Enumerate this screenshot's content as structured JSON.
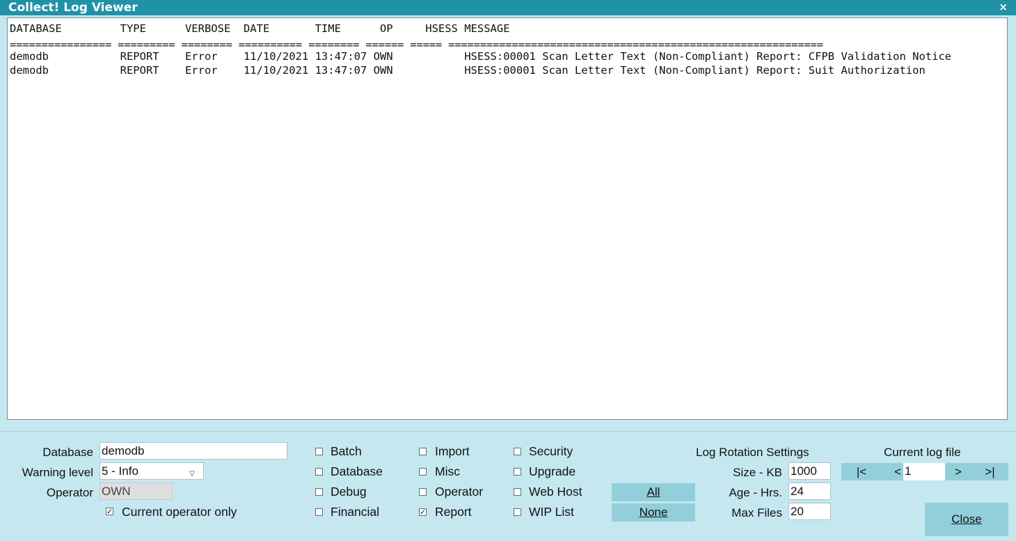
{
  "window": {
    "title": "Collect! Log Viewer",
    "close_glyph": "×"
  },
  "log": {
    "header_line": "DATABASE         TYPE      VERBOSE  DATE       TIME      OP     HSESS MESSAGE",
    "rule_line": "================ ========= ======== ========== ======== ====== ===== ===========================================================",
    "rows": [
      "demodb           REPORT    Error    11/10/2021 13:47:07 OWN           HSESS:00001 Scan Letter Text (Non-Compliant) Report: CFPB Validation Notice",
      "demodb           REPORT    Error    11/10/2021 13:47:07 OWN           HSESS:00001 Scan Letter Text (Non-Compliant) Report: Suit Authorization"
    ]
  },
  "filters": {
    "database_label": "Database",
    "database_value": "demodb",
    "warning_label": "Warning level",
    "warning_value": "5 - Info",
    "operator_label": "Operator",
    "operator_value": "OWN",
    "current_operator_label": "Current operator only",
    "current_operator_checked": true
  },
  "types": [
    {
      "label": "Batch",
      "checked": false
    },
    {
      "label": "Database",
      "checked": false
    },
    {
      "label": "Debug",
      "checked": false
    },
    {
      "label": "Financial",
      "checked": false
    },
    {
      "label": "Import",
      "checked": false
    },
    {
      "label": "Misc",
      "checked": false
    },
    {
      "label": "Operator",
      "checked": false
    },
    {
      "label": "Report",
      "checked": true
    },
    {
      "label": "Security",
      "checked": false
    },
    {
      "label": "Upgrade",
      "checked": false
    },
    {
      "label": "Web Host",
      "checked": false
    },
    {
      "label": "WIP List",
      "checked": false
    }
  ],
  "buttons": {
    "all": "All",
    "none": "None",
    "close": "Close"
  },
  "rotation": {
    "title": "Log Rotation Settings",
    "size_label": "Size - KB",
    "size_value": "1000",
    "age_label": "Age - Hrs.",
    "age_value": "24",
    "maxfiles_label": "Max Files",
    "maxfiles_value": "20"
  },
  "current_log": {
    "title": "Current log file",
    "first": "|<",
    "prev": "<",
    "value": "1",
    "next": ">",
    "last": ">|"
  },
  "check_glyph": "✓",
  "colors": {
    "titlebar": "#1f92a8",
    "background": "#c5e8f0",
    "button": "#93cfdb"
  }
}
